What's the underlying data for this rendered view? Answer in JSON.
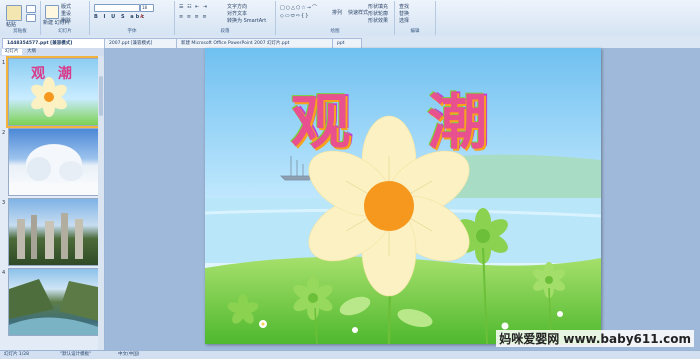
{
  "ribbon": {
    "groups": [
      {
        "label": "剪贴板"
      },
      {
        "label": "幻灯片"
      },
      {
        "label": "字体"
      },
      {
        "label": "段落"
      },
      {
        "label": "绘图"
      },
      {
        "label": "编辑"
      }
    ],
    "paste_label": "粘贴",
    "new_slide_label": "新建\n幻灯片",
    "layout_label": "版式",
    "reset_label": "重设",
    "delete_label": "删除",
    "font_size_value": "18",
    "text_direction_label": "文字方向",
    "align_text_label": "对齐文本",
    "smartart_label": "转换为 SmartArt",
    "arrange_label": "排列",
    "quick_styles_label": "快速样式",
    "shape_fill_label": "形状填充",
    "shape_outline_label": "形状轮廓",
    "shape_effects_label": "形状效果",
    "find_label": "查找",
    "replace_label": "替换",
    "select_label": "选择"
  },
  "doc_tabs": [
    {
      "label": "1448354577.ppt [兼容模式]"
    },
    {
      "label": "2007.ppt [兼容模式]"
    },
    {
      "label": "新建 Microsoft Office PowerPoint 2007 幻灯片.ppt"
    },
    {
      "label": "ppt"
    }
  ],
  "panel": {
    "tab_slides": "幻灯片",
    "tab_outline": "大纲"
  },
  "thumbs": [
    {
      "num": "1",
      "title": "观 潮"
    },
    {
      "num": "2"
    },
    {
      "num": "3"
    },
    {
      "num": "4"
    }
  ],
  "slide": {
    "title": "观  潮"
  },
  "status": {
    "slide_info": "幻灯片 1/28",
    "theme": "\"默认设计模板\"",
    "language": "中文(中国)"
  },
  "watermark": "妈咪爱婴网 www.baby611.com",
  "colors": {
    "accent": "#f6981e",
    "petal": "#fbf1c2",
    "sky": "#8ccdf2",
    "grass": "#7cd152"
  }
}
